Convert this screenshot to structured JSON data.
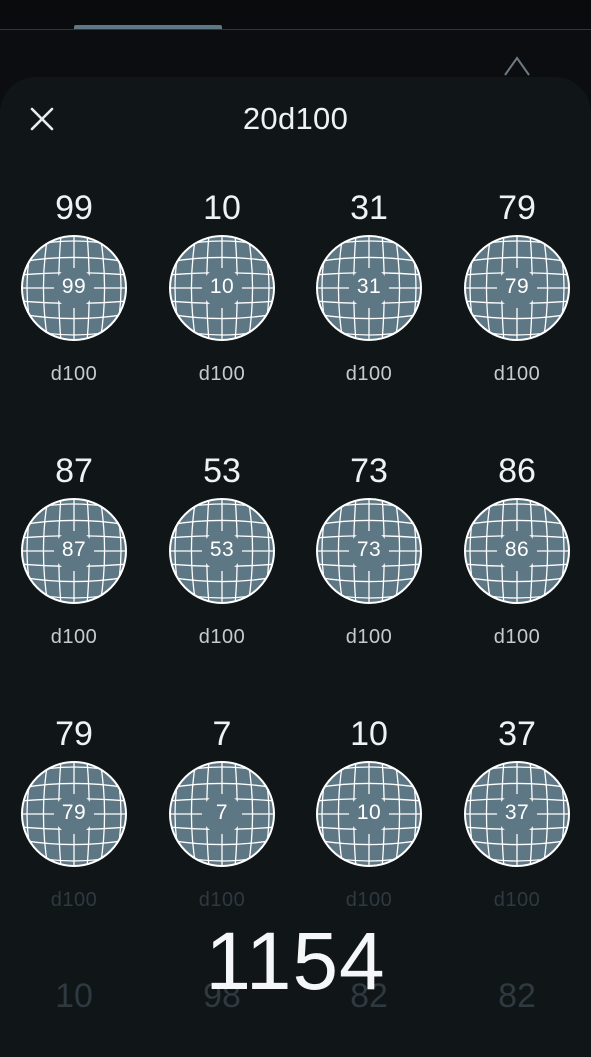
{
  "sheet": {
    "title": "20d100",
    "total": "1154"
  },
  "colors": {
    "background": "#0b0d10",
    "sheet": "#101518",
    "die_fill": "#5e7784",
    "text": "#eef2f4"
  },
  "icons": {
    "close": "close-icon",
    "die": "d100-die-icon",
    "chevron": "chevron-up-icon"
  },
  "dice": [
    {
      "result": "99",
      "face": "99",
      "type": "d100"
    },
    {
      "result": "10",
      "face": "10",
      "type": "d100"
    },
    {
      "result": "31",
      "face": "31",
      "type": "d100"
    },
    {
      "result": "79",
      "face": "79",
      "type": "d100"
    },
    {
      "result": "87",
      "face": "87",
      "type": "d100"
    },
    {
      "result": "53",
      "face": "53",
      "type": "d100"
    },
    {
      "result": "73",
      "face": "73",
      "type": "d100"
    },
    {
      "result": "86",
      "face": "86",
      "type": "d100"
    },
    {
      "result": "79",
      "face": "79",
      "type": "d100"
    },
    {
      "result": "7",
      "face": "7",
      "type": "d100"
    },
    {
      "result": "10",
      "face": "10",
      "type": "d100"
    },
    {
      "result": "37",
      "face": "37",
      "type": "d100"
    }
  ],
  "next_row_results": [
    "10",
    "98",
    "82",
    "82"
  ]
}
